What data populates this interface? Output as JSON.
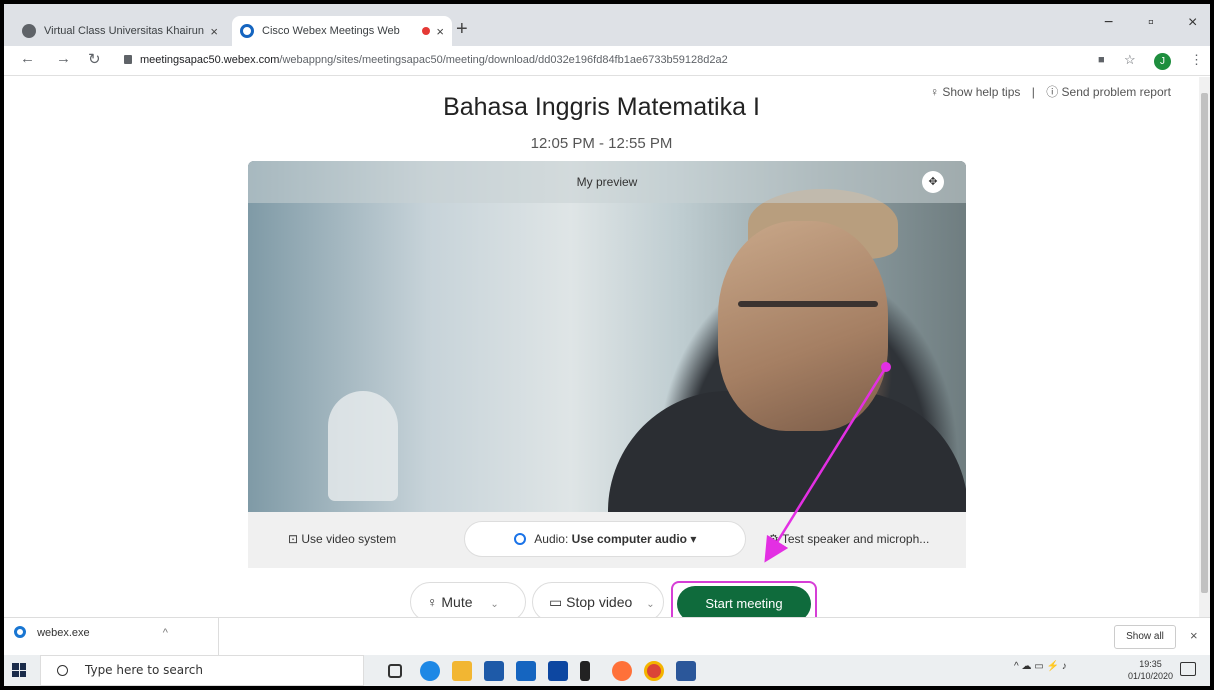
{
  "browser": {
    "tabs": [
      {
        "title": "Virtual Class Universitas Khairun",
        "close": "×",
        "favicon_color": "#5f6368"
      },
      {
        "title": "Cisco Webex Meetings Web",
        "close": "×",
        "favicon_color": "#1565c0"
      }
    ],
    "new_tab": "+",
    "window_controls": [
      "−",
      "▫",
      "×"
    ],
    "url_domain": "meetingsapac50.webex.com",
    "url_path": "/webappng/sites/meetingsapac50/meeting/download/dd032e196fd84fb1ae6733b59128d2a2",
    "avatar_initial": "J"
  },
  "meeting": {
    "help_tips": "Show help tips",
    "separator": "|",
    "send_report": "Send problem report",
    "title": "Bahasa Inggris Matematika I",
    "time": "12:05 PM - 12:55 PM",
    "preview_label": "My preview",
    "use_video_system": "Use video system",
    "audio_prefix": "Audio:",
    "audio_value": "Use computer audio",
    "test_speaker": "Test speaker and microph...",
    "mute": "Mute",
    "stop_video": "Stop video",
    "start_meeting": "Start meeting",
    "accent_color": "#0f6b3c",
    "highlight_color": "#d63ed6"
  },
  "downloads": {
    "file": "webex.exe",
    "show_all": "Show all",
    "close": "×"
  },
  "taskbar": {
    "search_placeholder": "Type here to search",
    "time": "19:35",
    "date": "01/10/2020"
  }
}
